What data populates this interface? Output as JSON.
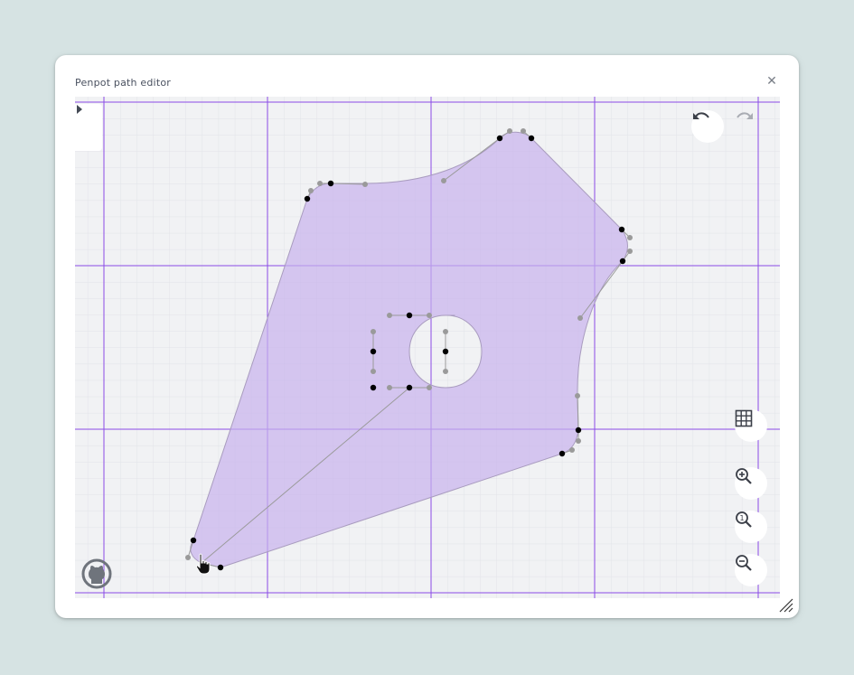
{
  "window": {
    "title": "Penpot path editor"
  },
  "icons": {
    "close": "close-icon",
    "undo": "undo-icon",
    "redo": "redo-icon",
    "grid": "grid-icon",
    "zoom_in": "zoom-in-icon",
    "zoom_reset": "zoom-reset-icon",
    "zoom_out": "zoom-out-icon",
    "sidebar": "chevron-right-icon",
    "github": "github-icon",
    "cursor": "hand-pointer-icon"
  },
  "colors": {
    "accent": "#7c3aed",
    "shape_fill": "#d6c8ee",
    "background": "#d6e3e3",
    "node_anchor": "#000000",
    "node_handle": "#999999"
  },
  "zoom_reset_label": "1"
}
